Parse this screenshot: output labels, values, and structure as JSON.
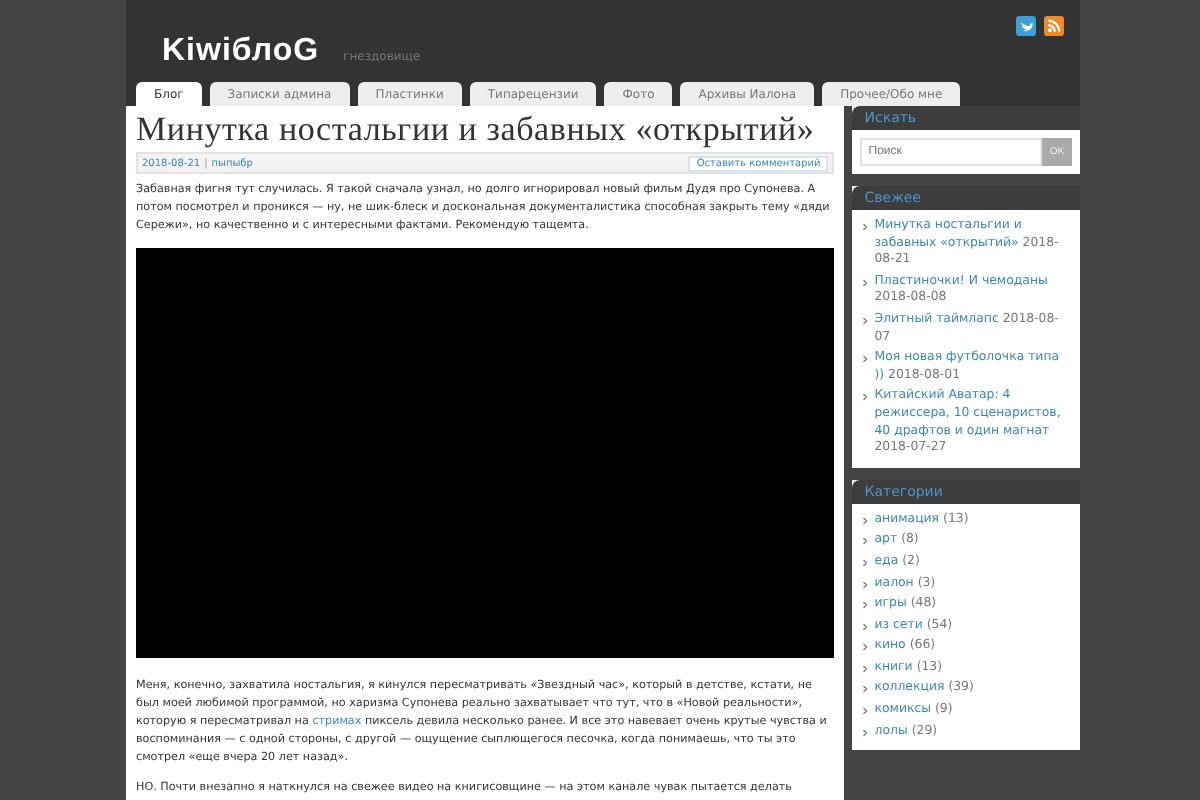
{
  "header": {
    "logo": "KiwiблоG",
    "tagline": "гнездовище"
  },
  "tabs": [
    {
      "label": "Блог",
      "selected": true
    },
    {
      "label": "Записки админа",
      "selected": false
    },
    {
      "label": "Пластинки",
      "selected": false
    },
    {
      "label": "Типарецензии",
      "selected": false
    },
    {
      "label": "Фото",
      "selected": false
    },
    {
      "label": "Архивы Иалона",
      "selected": false
    },
    {
      "label": "Прочее/Обо мне",
      "selected": false
    }
  ],
  "post": {
    "title": "Минутка ностальгии и забавных «открытий»",
    "date": "2018-08-21",
    "separator": "|",
    "category": "пыпыбр",
    "comment_link": "Оставить комментарий",
    "intro": "Забавная фигня тут случилась. Я такой сначала узнал, но долго игнорировал новый фильм Дудя про Супонева. А потом посмотрел и проникся — ну, не шик-блеск и доскональная документалистика способная закрыть тему «дяди Сережи», но качественно и с интересными фактами. Рекомендую тащемта.",
    "paragraph": {
      "before": "Меня, конечно, захватила ностальгия, я кинулся пересматривать «Звездный час», который в детстве, кстати, не был моей любимой программой, но харизма Супонева реально захватывает что тут, что в «Новой реальности», которую я пересматривал на",
      "link": "стримах",
      "after": "пиксель девила несколько ранее. И все это навевает очень крутые чувства и воспоминания — с одной стороны, с другой — ощущение сыплющегося песочка, когда понимаешь, что ты это смотрел «еще вчера 20 лет назад»."
    },
    "last_line": "НО. Почти внезапно я наткнулся на свежее видео на книгисовщине — на этом канале чувак пытается делать"
  },
  "sidebar": {
    "search": {
      "heading": "Искать",
      "placeholder": "Поиск",
      "button": "OK"
    },
    "recent": {
      "heading": "Свежее",
      "items": [
        {
          "title": "Минутка ностальгии и забавных «открытий»",
          "date": "2018-08-21"
        },
        {
          "title": "Пластиночки! И чемоданы",
          "date": "2018-08-08"
        },
        {
          "title": "Элитный таймлапс",
          "date": "2018-08-07"
        },
        {
          "title": "Моя новая футболочка типа ))",
          "date": "2018-08-01"
        },
        {
          "title": "Китайский Аватар: 4 режиссера, 10 сценаристов, 40 драфтов и один магнат",
          "date": "2018-07-27"
        }
      ]
    },
    "categories": {
      "heading": "Категории",
      "items": [
        {
          "name": "анимация",
          "count": "(13)"
        },
        {
          "name": "арт",
          "count": "(8)"
        },
        {
          "name": "еда",
          "count": "(2)"
        },
        {
          "name": "иалон",
          "count": "(3)"
        },
        {
          "name": "игры",
          "count": "(48)"
        },
        {
          "name": "из сети",
          "count": "(54)"
        },
        {
          "name": "кино",
          "count": "(66)"
        },
        {
          "name": "книги",
          "count": "(13)"
        },
        {
          "name": "коллекция",
          "count": "(39)"
        },
        {
          "name": "комиксы",
          "count": "(9)"
        },
        {
          "name": "лолы",
          "count": "(29)"
        }
      ]
    }
  }
}
